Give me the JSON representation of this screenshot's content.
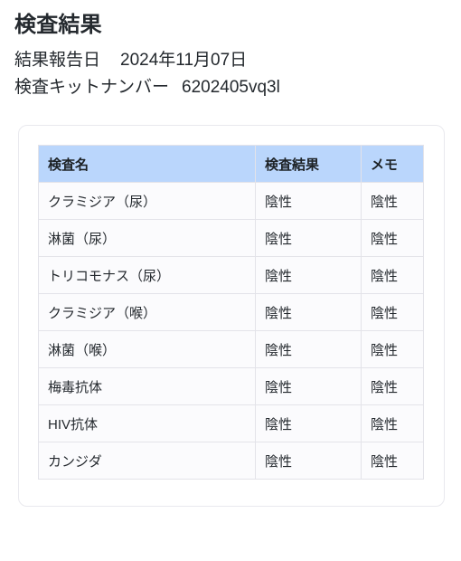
{
  "header": {
    "title": "検査結果",
    "report_date_label": "結果報告日",
    "report_date_value": "2024年11月07日",
    "kit_number_label": "検査キットナンバー",
    "kit_number_value": "6202405vq3l"
  },
  "table": {
    "columns": [
      "検査名",
      "検査結果",
      "メモ"
    ],
    "rows": [
      {
        "name": "クラミジア（尿）",
        "result": "陰性",
        "memo": "陰性"
      },
      {
        "name": "淋菌（尿）",
        "result": "陰性",
        "memo": "陰性"
      },
      {
        "name": "トリコモナス（尿）",
        "result": "陰性",
        "memo": "陰性"
      },
      {
        "name": "クラミジア（喉）",
        "result": "陰性",
        "memo": "陰性"
      },
      {
        "name": "淋菌（喉）",
        "result": "陰性",
        "memo": "陰性"
      },
      {
        "name": "梅毒抗体",
        "result": "陰性",
        "memo": "陰性"
      },
      {
        "name": "HIV抗体",
        "result": "陰性",
        "memo": "陰性"
      },
      {
        "name": "カンジダ",
        "result": "陰性",
        "memo": "陰性"
      }
    ]
  },
  "colors": {
    "table_header_bg": "#bad6fc",
    "cell_bg": "#fbfbfd",
    "cell_border": "#e3e3e9",
    "card_border": "#e9e9ee",
    "text": "#24292e",
    "page_bg": "#ffffff"
  }
}
